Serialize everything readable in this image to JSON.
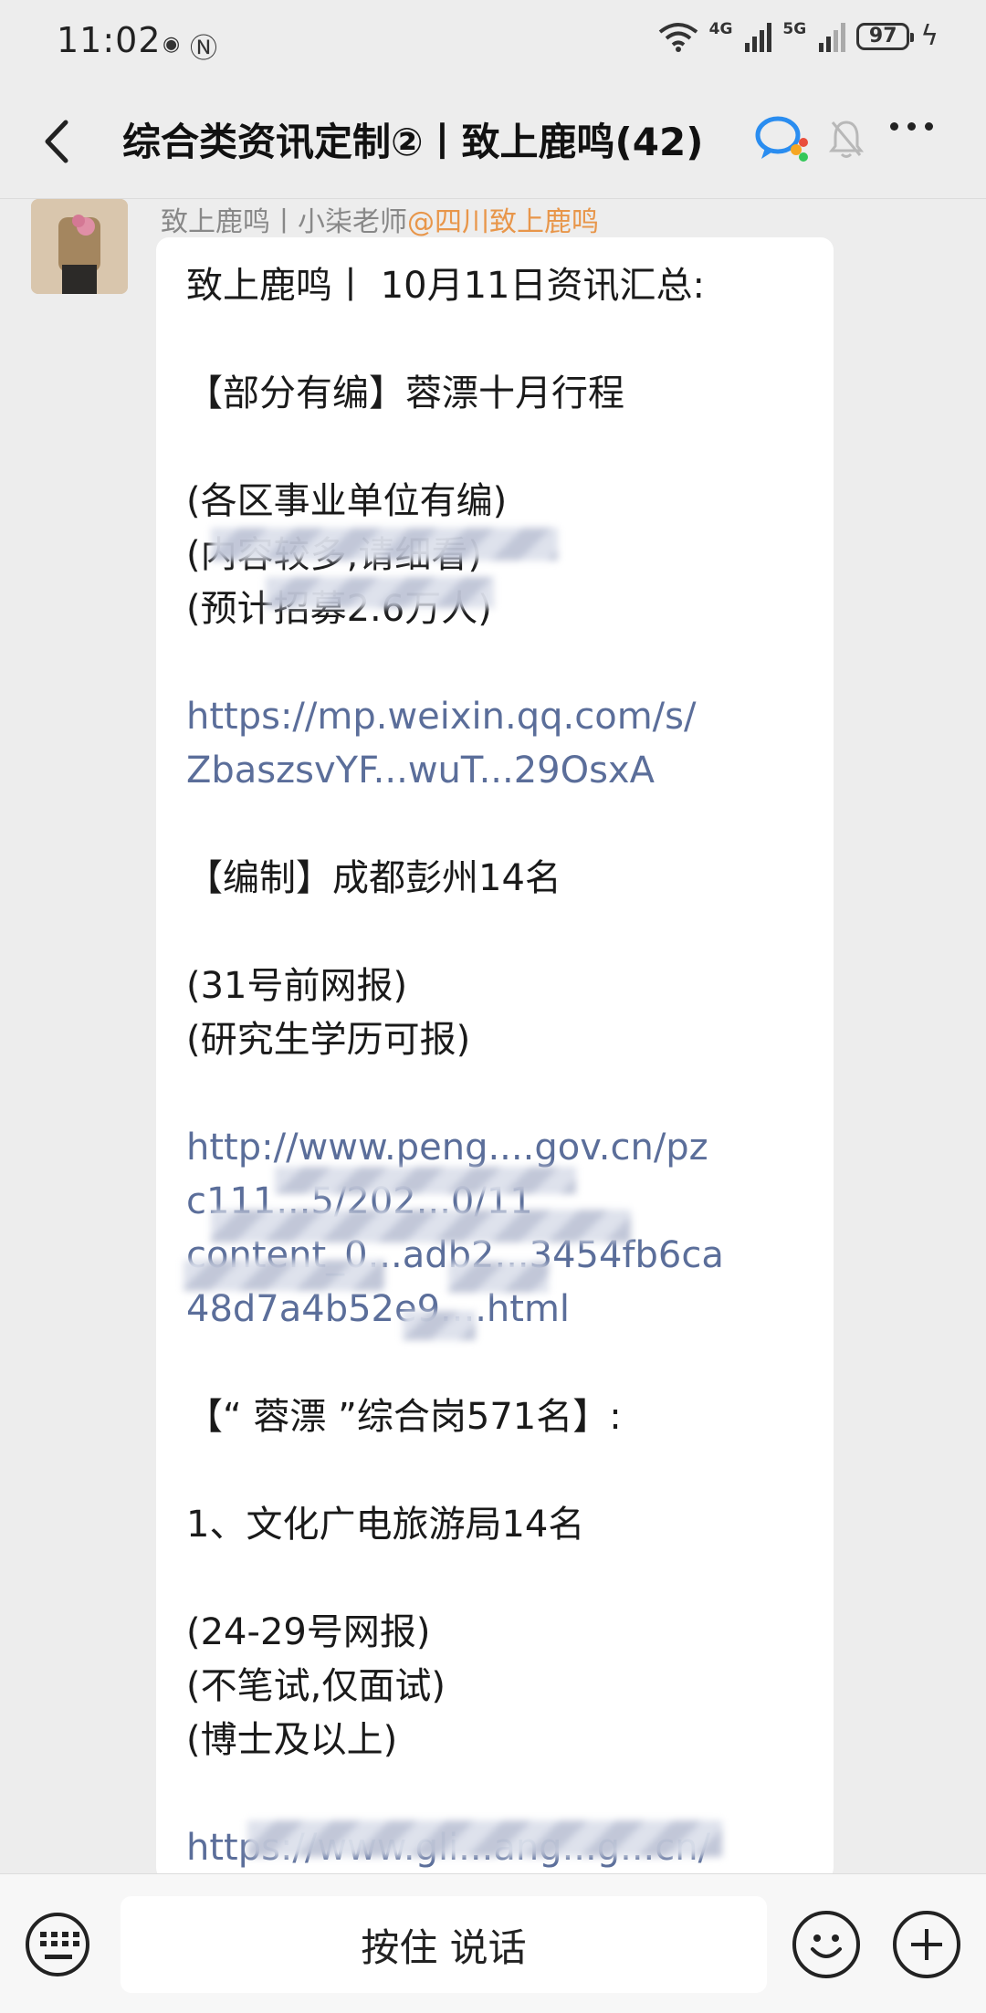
{
  "status_bar": {
    "time": "11:02",
    "network_1": "4G",
    "network_2": "5G",
    "battery": "97"
  },
  "header": {
    "title": "综合类资讯定制②丨致上鹿鸣(42)"
  },
  "message": {
    "sender_name": "致上鹿鸣丨小柒老师",
    "sender_mention": "@四川致上鹿鸣",
    "lines": [
      "致上鹿鸣丨 10月11日资讯汇总:",
      "",
      "【部分有编】蓉漂十月行程",
      "",
      "(各区事业单位有编)",
      "(内容较多,请细看)",
      "(预计招募2.6万人)",
      "",
      "https://mp.weixin.qq.com/s/",
      "ZbaszsvYF...wuT...29OsxA",
      "",
      "【编制】成都彭州14名",
      "",
      "(31号前网报)",
      "(研究生学历可报)",
      "",
      "http://www.peng....gov.cn/pz",
      "c111...5/202...0/11",
      "content_0...adb2...3454fb6ca",
      "48d7a4b52e9....html",
      "",
      "【“ 蓉漂 ”综合岗571名】:",
      "",
      "1、文化广电旅游局14名",
      "",
      "(24-29号网报)",
      "(不笔试,仅面试)",
      "(博士及以上)",
      "",
      "https://www.gli...ang...g...cn/"
    ]
  },
  "input_bar": {
    "talk_label": "按住 说话"
  }
}
